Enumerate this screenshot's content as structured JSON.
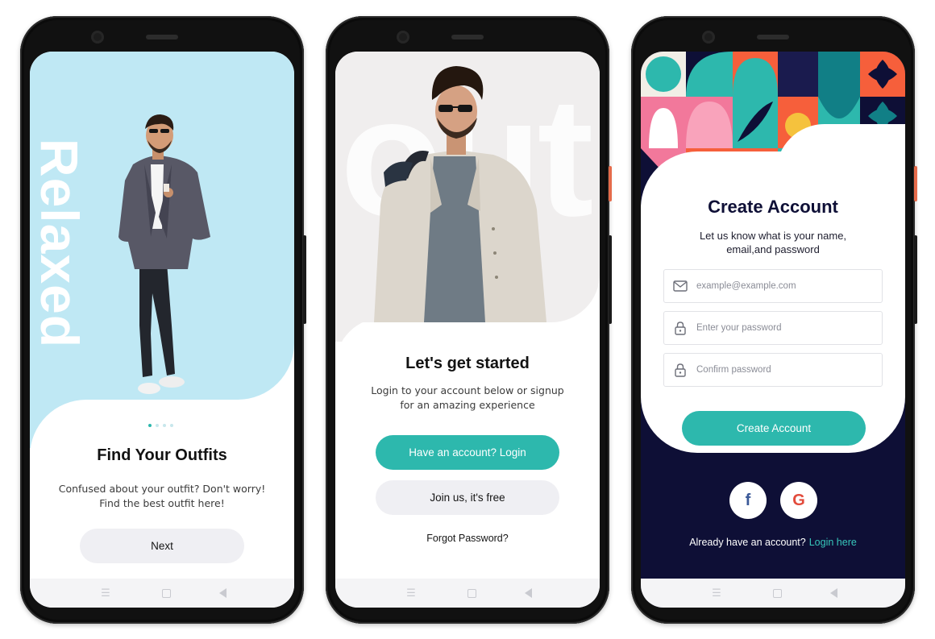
{
  "colors": {
    "accent": "#2db8ad",
    "sky": "#bfe8f4",
    "navy": "#0e0f36",
    "light_button": "#efeff3",
    "coral": "#f65f3b",
    "pink": "#f2789b",
    "yellow": "#f5c23d"
  },
  "screen1": {
    "vertical_word": "Relaxed",
    "pager": {
      "total": 4,
      "active": 1
    },
    "title": "Find Your Outfits",
    "description_line1": "Confused about your outfit? Don't worry!",
    "description_line2": "Find the best outfit here!",
    "next_label": "Next"
  },
  "screen2": {
    "background_word": "out",
    "title": "Let's get started",
    "description_line1": "Login to your account below or signup",
    "description_line2": "for an amazing experience",
    "login_label": "Have an account? Login",
    "join_label": "Join us, it's free",
    "forgot_label": "Forgot Password?"
  },
  "screen3": {
    "title": "Create Account",
    "description_line1": "Let us know what is your name,",
    "description_line2": "email,and password",
    "email_placeholder": "example@example.com",
    "password_placeholder": "Enter your password",
    "confirm_placeholder": "Confirm password",
    "create_label": "Create Account",
    "social_icons": [
      "facebook-icon",
      "google-icon"
    ],
    "facebook_glyph": "f",
    "google_glyph": "G",
    "footer_text": "Already have an account?",
    "footer_link": "Login here"
  },
  "navbar": {
    "menu_glyph": "☰"
  }
}
